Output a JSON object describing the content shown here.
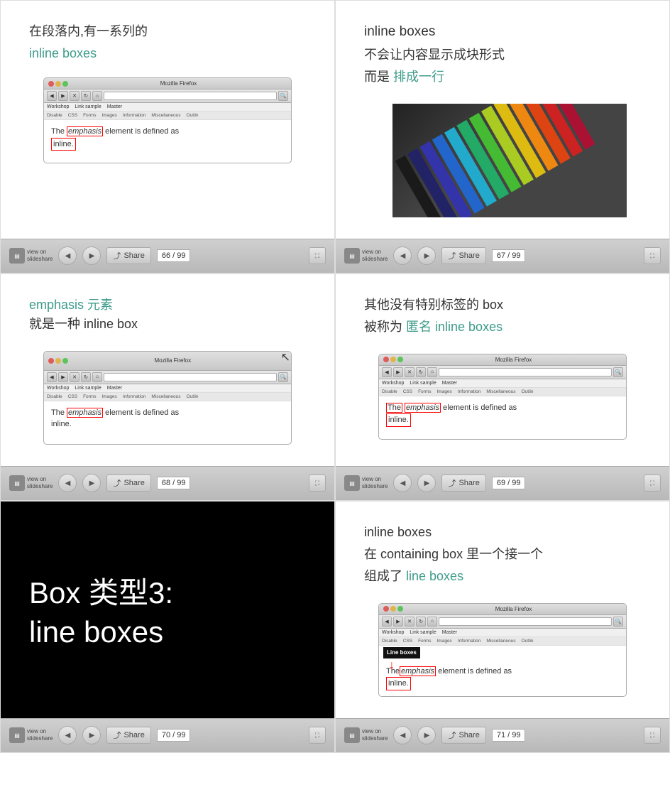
{
  "cells": [
    {
      "id": "cell-1",
      "chinese_line1": "在段落内,有一系列的",
      "teal_line": "inline boxes",
      "page_num": "66 / 99",
      "has_browser": true,
      "browser_content_type": "emphasis-inline"
    },
    {
      "id": "cell-2",
      "black_line1": "inline boxes",
      "chinese_line1": "不会让内容显示成块形式",
      "chinese_line2": "而是",
      "teal_inline": "排成一行",
      "page_num": "67 / 99",
      "has_pencils": true
    },
    {
      "id": "cell-3",
      "teal_line": "emphasis 元素",
      "chinese_line1": "就是一种 inline box",
      "page_num": "68 / 99",
      "has_browser": true,
      "browser_content_type": "emphasis-cursor"
    },
    {
      "id": "cell-4",
      "chinese_line1": "其他没有特别标签的 box",
      "chinese_line2": "被称为",
      "teal_inline": "匿名 inline boxes",
      "page_num": "69 / 99",
      "has_browser": true,
      "browser_content_type": "anonymous-inline"
    },
    {
      "id": "cell-5",
      "black_heading_line1": "Box 类型3:",
      "black_heading_line2": "line boxes",
      "page_num": "70 / 99"
    },
    {
      "id": "cell-6",
      "black_line1": "inline boxes",
      "chinese_line1": "在 containing box 里一个接一个",
      "chinese_line2": "组成了",
      "teal_inline": "line boxes",
      "page_num": "71 / 99",
      "has_browser": true,
      "browser_content_type": "line-boxes"
    }
  ],
  "slideshare": {
    "view_on": "view on",
    "brand": "slideshare",
    "share_label": "Share",
    "prev_icon": "◀",
    "next_icon": "▶",
    "fullscreen_icon": "⛶"
  },
  "browser": {
    "title": "Mozilla Firefox",
    "dots": [
      "red",
      "yellow",
      "green"
    ],
    "menu_items": [
      "Workshop",
      "Link sample",
      "Master"
    ],
    "dev_items": [
      "Disable",
      "CSS",
      "Forms",
      "Images",
      "Information",
      "Miscellaneous",
      "Outlin"
    ],
    "content_text": "The",
    "emphasis_text": "emphasis",
    "rest_text": "element is defined as",
    "inline_text": "inline.",
    "line_boxes_label": "Line boxes"
  }
}
